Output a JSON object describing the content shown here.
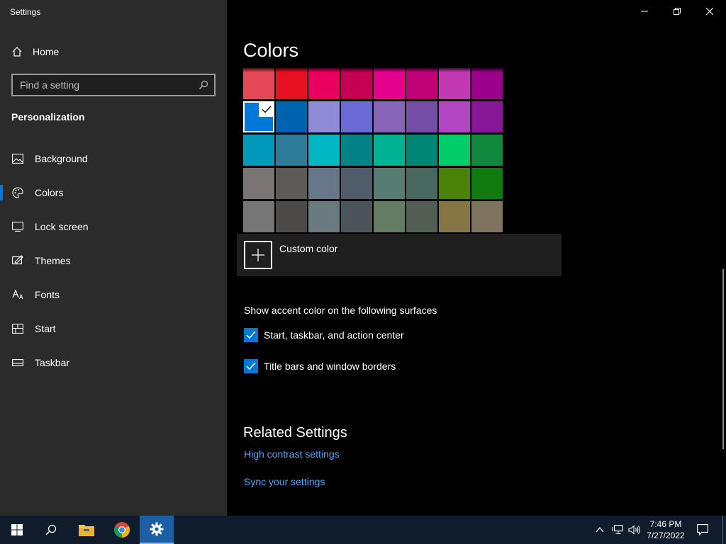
{
  "window": {
    "title": "Settings"
  },
  "sidebar": {
    "home_label": "Home",
    "search_placeholder": "Find a setting",
    "section_title": "Personalization",
    "items": [
      {
        "label": "Background",
        "icon": "image-icon",
        "active": false
      },
      {
        "label": "Colors",
        "icon": "palette-icon",
        "active": true
      },
      {
        "label": "Lock screen",
        "icon": "lock-screen-icon",
        "active": false
      },
      {
        "label": "Themes",
        "icon": "themes-icon",
        "active": false
      },
      {
        "label": "Fonts",
        "icon": "fonts-icon",
        "active": false
      },
      {
        "label": "Start",
        "icon": "start-icon",
        "active": false
      },
      {
        "label": "Taskbar",
        "icon": "taskbar-icon",
        "active": false
      }
    ]
  },
  "main": {
    "title": "Colors",
    "swatches": [
      [
        "#e74856",
        "#e81123",
        "#ea005e",
        "#c30052",
        "#e3008c",
        "#bf0077",
        "#c239b3",
        "#9a0089"
      ],
      [
        "#0078d7",
        "#0063b1",
        "#8e8cd8",
        "#6b69d6",
        "#8764b8",
        "#744da9",
        "#b146c2",
        "#881798"
      ],
      [
        "#0099bc",
        "#2d7d9a",
        "#00b7c3",
        "#038387",
        "#00b294",
        "#018574",
        "#00cc6a",
        "#10893e"
      ],
      [
        "#7a7574",
        "#5d5a58",
        "#68768a",
        "#515c6b",
        "#567c73",
        "#486860",
        "#498205",
        "#107c10"
      ],
      [
        "#767676",
        "#4c4a48",
        "#69797e",
        "#4a5459",
        "#647c64",
        "#525e54",
        "#847545",
        "#7e735f"
      ]
    ],
    "selected_swatch": {
      "row": 1,
      "col": 0
    },
    "custom_color_label": "Custom color",
    "surfaces_title": "Show accent color on the following surfaces",
    "checkboxes": [
      {
        "label": "Start, taskbar, and action center",
        "checked": true
      },
      {
        "label": "Title bars and window borders",
        "checked": true
      }
    ],
    "related_title": "Related Settings",
    "links": [
      "High contrast settings",
      "Sync your settings"
    ]
  },
  "taskbar": {
    "time": "7:46 PM",
    "date": "7/27/2022",
    "accent": "#0078d7"
  }
}
